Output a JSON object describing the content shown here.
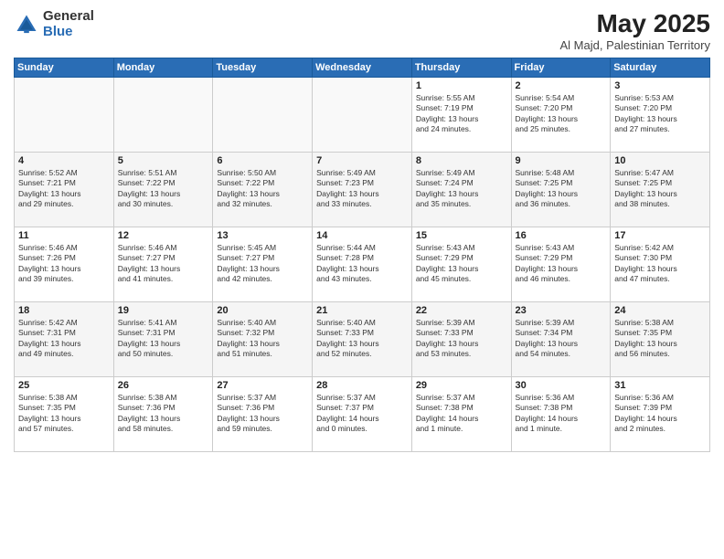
{
  "logo": {
    "general": "General",
    "blue": "Blue"
  },
  "title": "May 2025",
  "subtitle": "Al Majd, Palestinian Territory",
  "days_of_week": [
    "Sunday",
    "Monday",
    "Tuesday",
    "Wednesday",
    "Thursday",
    "Friday",
    "Saturday"
  ],
  "weeks": [
    [
      {
        "day": "",
        "info": ""
      },
      {
        "day": "",
        "info": ""
      },
      {
        "day": "",
        "info": ""
      },
      {
        "day": "",
        "info": ""
      },
      {
        "day": "1",
        "info": "Sunrise: 5:55 AM\nSunset: 7:19 PM\nDaylight: 13 hours\nand 24 minutes."
      },
      {
        "day": "2",
        "info": "Sunrise: 5:54 AM\nSunset: 7:20 PM\nDaylight: 13 hours\nand 25 minutes."
      },
      {
        "day": "3",
        "info": "Sunrise: 5:53 AM\nSunset: 7:20 PM\nDaylight: 13 hours\nand 27 minutes."
      }
    ],
    [
      {
        "day": "4",
        "info": "Sunrise: 5:52 AM\nSunset: 7:21 PM\nDaylight: 13 hours\nand 29 minutes."
      },
      {
        "day": "5",
        "info": "Sunrise: 5:51 AM\nSunset: 7:22 PM\nDaylight: 13 hours\nand 30 minutes."
      },
      {
        "day": "6",
        "info": "Sunrise: 5:50 AM\nSunset: 7:22 PM\nDaylight: 13 hours\nand 32 minutes."
      },
      {
        "day": "7",
        "info": "Sunrise: 5:49 AM\nSunset: 7:23 PM\nDaylight: 13 hours\nand 33 minutes."
      },
      {
        "day": "8",
        "info": "Sunrise: 5:49 AM\nSunset: 7:24 PM\nDaylight: 13 hours\nand 35 minutes."
      },
      {
        "day": "9",
        "info": "Sunrise: 5:48 AM\nSunset: 7:25 PM\nDaylight: 13 hours\nand 36 minutes."
      },
      {
        "day": "10",
        "info": "Sunrise: 5:47 AM\nSunset: 7:25 PM\nDaylight: 13 hours\nand 38 minutes."
      }
    ],
    [
      {
        "day": "11",
        "info": "Sunrise: 5:46 AM\nSunset: 7:26 PM\nDaylight: 13 hours\nand 39 minutes."
      },
      {
        "day": "12",
        "info": "Sunrise: 5:46 AM\nSunset: 7:27 PM\nDaylight: 13 hours\nand 41 minutes."
      },
      {
        "day": "13",
        "info": "Sunrise: 5:45 AM\nSunset: 7:27 PM\nDaylight: 13 hours\nand 42 minutes."
      },
      {
        "day": "14",
        "info": "Sunrise: 5:44 AM\nSunset: 7:28 PM\nDaylight: 13 hours\nand 43 minutes."
      },
      {
        "day": "15",
        "info": "Sunrise: 5:43 AM\nSunset: 7:29 PM\nDaylight: 13 hours\nand 45 minutes."
      },
      {
        "day": "16",
        "info": "Sunrise: 5:43 AM\nSunset: 7:29 PM\nDaylight: 13 hours\nand 46 minutes."
      },
      {
        "day": "17",
        "info": "Sunrise: 5:42 AM\nSunset: 7:30 PM\nDaylight: 13 hours\nand 47 minutes."
      }
    ],
    [
      {
        "day": "18",
        "info": "Sunrise: 5:42 AM\nSunset: 7:31 PM\nDaylight: 13 hours\nand 49 minutes."
      },
      {
        "day": "19",
        "info": "Sunrise: 5:41 AM\nSunset: 7:31 PM\nDaylight: 13 hours\nand 50 minutes."
      },
      {
        "day": "20",
        "info": "Sunrise: 5:40 AM\nSunset: 7:32 PM\nDaylight: 13 hours\nand 51 minutes."
      },
      {
        "day": "21",
        "info": "Sunrise: 5:40 AM\nSunset: 7:33 PM\nDaylight: 13 hours\nand 52 minutes."
      },
      {
        "day": "22",
        "info": "Sunrise: 5:39 AM\nSunset: 7:33 PM\nDaylight: 13 hours\nand 53 minutes."
      },
      {
        "day": "23",
        "info": "Sunrise: 5:39 AM\nSunset: 7:34 PM\nDaylight: 13 hours\nand 54 minutes."
      },
      {
        "day": "24",
        "info": "Sunrise: 5:38 AM\nSunset: 7:35 PM\nDaylight: 13 hours\nand 56 minutes."
      }
    ],
    [
      {
        "day": "25",
        "info": "Sunrise: 5:38 AM\nSunset: 7:35 PM\nDaylight: 13 hours\nand 57 minutes."
      },
      {
        "day": "26",
        "info": "Sunrise: 5:38 AM\nSunset: 7:36 PM\nDaylight: 13 hours\nand 58 minutes."
      },
      {
        "day": "27",
        "info": "Sunrise: 5:37 AM\nSunset: 7:36 PM\nDaylight: 13 hours\nand 59 minutes."
      },
      {
        "day": "28",
        "info": "Sunrise: 5:37 AM\nSunset: 7:37 PM\nDaylight: 14 hours\nand 0 minutes."
      },
      {
        "day": "29",
        "info": "Sunrise: 5:37 AM\nSunset: 7:38 PM\nDaylight: 14 hours\nand 1 minute."
      },
      {
        "day": "30",
        "info": "Sunrise: 5:36 AM\nSunset: 7:38 PM\nDaylight: 14 hours\nand 1 minute."
      },
      {
        "day": "31",
        "info": "Sunrise: 5:36 AM\nSunset: 7:39 PM\nDaylight: 14 hours\nand 2 minutes."
      }
    ]
  ]
}
